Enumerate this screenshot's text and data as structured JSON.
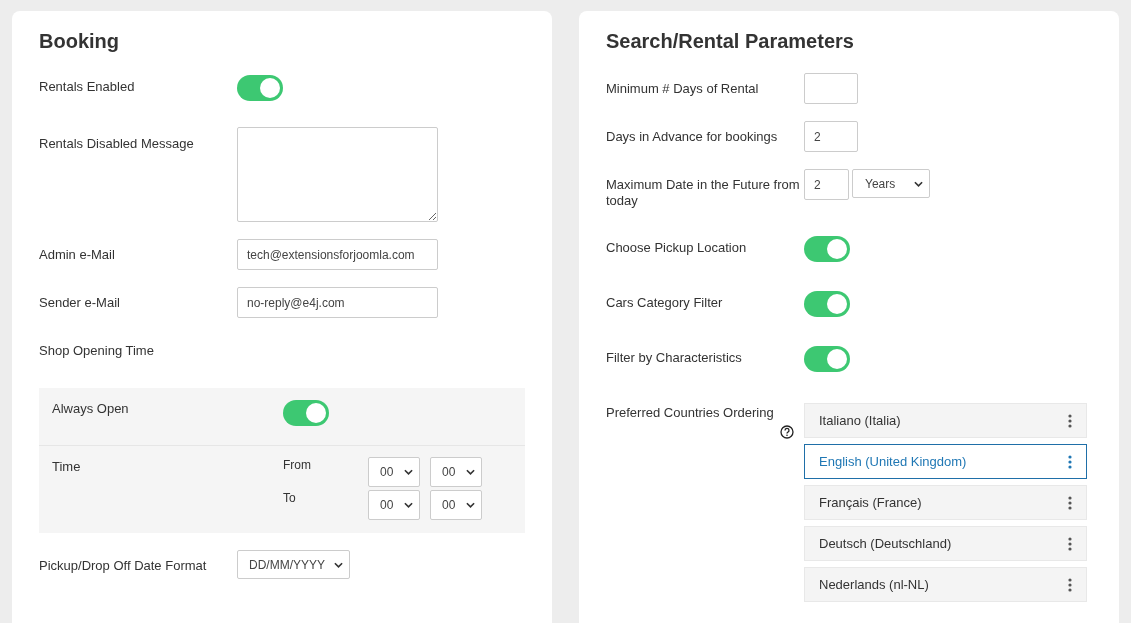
{
  "booking": {
    "title": "Booking",
    "fields": [
      {
        "kind": "toggle",
        "label": "Rentals Enabled",
        "on": true
      },
      {
        "kind": "textarea",
        "label": "Rentals Disabled Message"
      },
      {
        "kind": "input",
        "label": "Admin e-Mail",
        "value": "tech@extensionsforjoomla.com"
      },
      {
        "kind": "input",
        "label": "Sender e-Mail",
        "value": "no-reply@e4j.com"
      },
      {
        "kind": "heading",
        "label": "Shop Opening Time"
      },
      {
        "kind": "panel",
        "rows": [
          {
            "kind": "toggle",
            "label": "Always Open",
            "on": true
          },
          {
            "kind": "time",
            "label": "Time",
            "from_label": "From",
            "to_label": "To",
            "from": [
              "00",
              "00"
            ],
            "to": [
              "00",
              "00"
            ]
          }
        ]
      },
      {
        "kind": "select",
        "label": "Pickup/Drop Off Date Format",
        "value": "DD/MM/YYYY"
      }
    ]
  },
  "search": {
    "title": "Search/Rental Parameters",
    "fields": [
      {
        "kind": "small_input",
        "label": "Minimum # Days of Rental"
      },
      {
        "kind": "small_input",
        "label": "Days in Advance for bookings",
        "value": "2"
      },
      {
        "kind": "number_unit",
        "label": "Maximum Date in the Future from today",
        "value": "2",
        "unit": "Years"
      },
      {
        "kind": "toggle",
        "label": "Choose Pickup Location",
        "on": true
      },
      {
        "kind": "toggle",
        "label": "Cars Category Filter",
        "on": true
      },
      {
        "kind": "toggle",
        "label": "Filter by Characteristics",
        "on": true
      },
      {
        "kind": "sortable",
        "label": "Preferred Countries Ordering",
        "items": [
          {
            "label": "Italiano (Italia)",
            "selected": false
          },
          {
            "label": "English (United Kingdom)",
            "selected": true
          },
          {
            "label": "Français (France)",
            "selected": false
          },
          {
            "label": "Deutsch (Deutschland)",
            "selected": false
          },
          {
            "label": "Nederlands (nl-NL)",
            "selected": false
          }
        ]
      }
    ]
  }
}
